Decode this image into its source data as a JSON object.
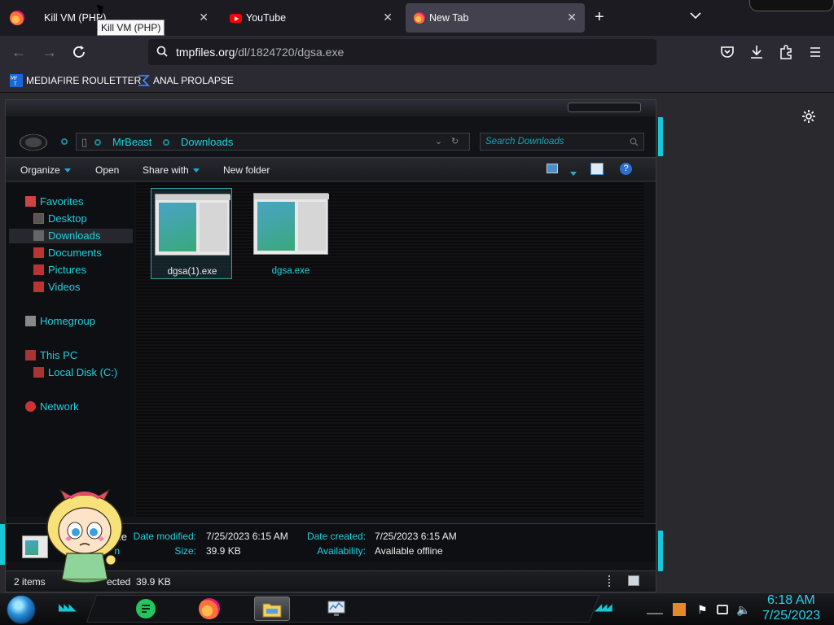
{
  "browser": {
    "tabs": [
      {
        "label": "Kill VM (PHP)",
        "favicon": "pointer-icon",
        "active": false
      },
      {
        "label": "YouTube",
        "favicon": "youtube-icon",
        "active": false
      },
      {
        "label": "New Tab",
        "favicon": "firefox-icon",
        "active": true
      }
    ],
    "tooltip": "Kill VM (PHP)",
    "url": {
      "host": "tmpfiles.org",
      "path": "/dl/1824720/dgsa.exe"
    },
    "bookmarks": [
      {
        "label": "MEDIAFIRE ROULETTER",
        "icon": "mft-icon"
      },
      {
        "label": "ANAL PROLAPSE",
        "icon": "sigma-icon"
      }
    ]
  },
  "explorer": {
    "breadcrumbs": [
      "MrBeast",
      "Downloads"
    ],
    "search_placeholder": "Search Downloads",
    "toolbar": {
      "organize": "Organize",
      "open": "Open",
      "share_with": "Share with",
      "new_folder": "New folder"
    },
    "nav": {
      "favorites": "Favorites",
      "desktop": "Desktop",
      "downloads": "Downloads",
      "documents": "Documents",
      "pictures": "Pictures",
      "videos": "Videos",
      "homegroup": "Homegroup",
      "this_pc": "This PC",
      "local_disk": "Local Disk (C:)",
      "network": "Network"
    },
    "files": [
      {
        "name": "dgsa(1).exe",
        "selected": true
      },
      {
        "name": "dgsa.exe",
        "selected": false
      }
    ],
    "details": {
      "name_fragment": "exe",
      "type_fragment": "n",
      "date_modified_label": "Date modified:",
      "date_modified": "7/25/2023 6:15 AM",
      "size_label": "Size:",
      "size": "39.9 KB",
      "date_created_label": "Date created:",
      "date_created": "7/25/2023 6:15 AM",
      "availability_label": "Availability:",
      "availability": "Available offline"
    },
    "status": {
      "items": "2 items",
      "selected_fragment": "ected",
      "selected_size": "39.9 KB"
    }
  },
  "taskbar": {
    "time": "6:18 AM",
    "date": "7/25/2023"
  },
  "colors": {
    "accent_cyan": "#1fd1de",
    "firefox_bg": "#1c1b22",
    "explorer_bg": "#121316"
  }
}
